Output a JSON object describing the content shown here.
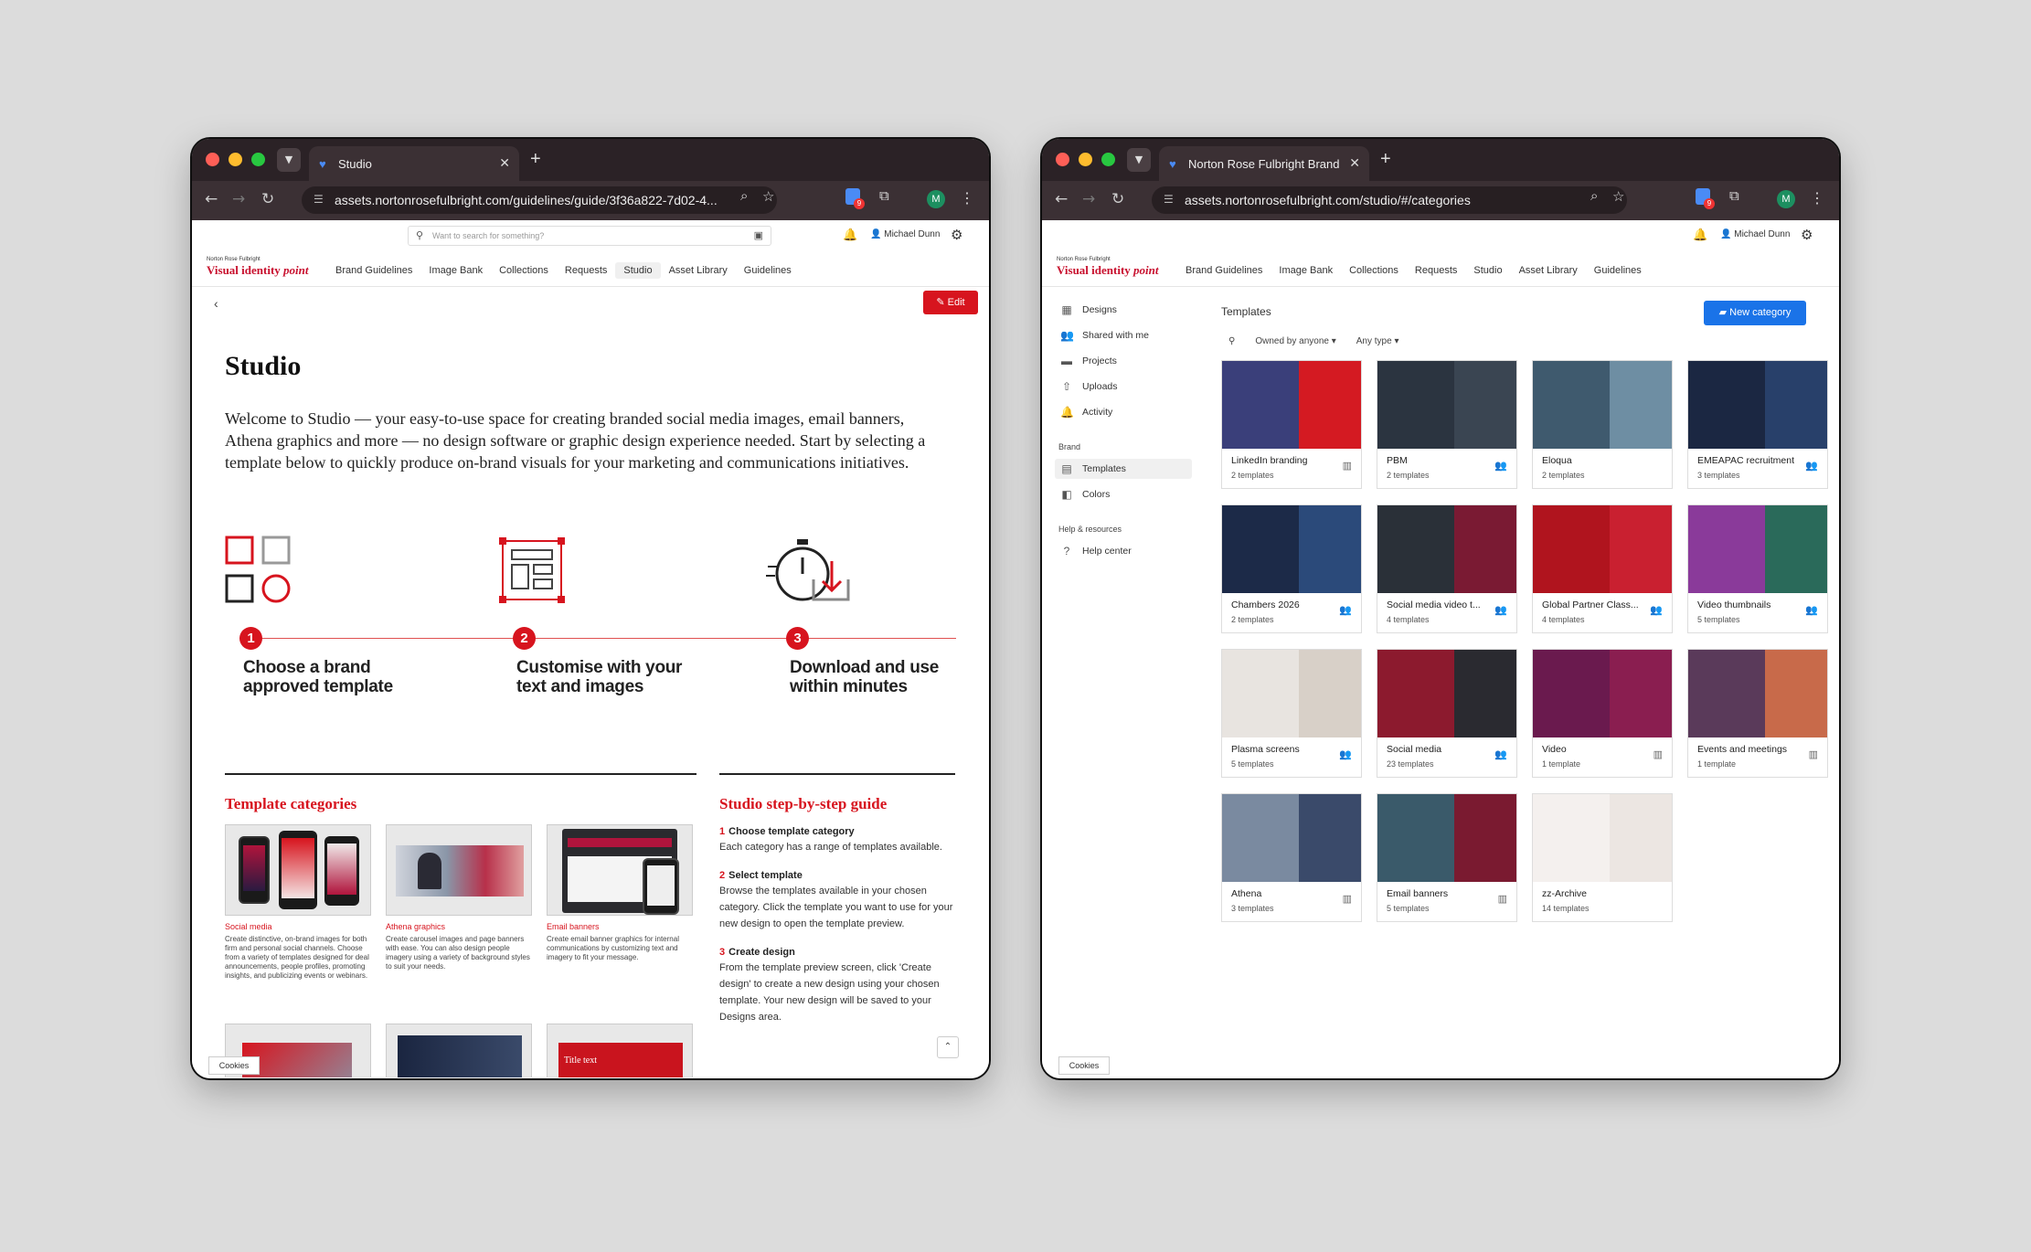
{
  "colors": {
    "brand_red": "#d7141e",
    "primary_blue": "#1a73e8",
    "chrome_dark": "#2b2226"
  },
  "win1": {
    "tab_title": "Studio",
    "url": "assets.nortonrosefulbright.com/guidelines/guide/3f36a822-7d02-4...",
    "search_placeholder": "Want to search for something?",
    "user": "Michael Dunn",
    "avatar": "M",
    "logo_small": "Norton Rose Fulbright",
    "logo_main": "Visual identity",
    "logo_em": "point",
    "nav": [
      "Brand Guidelines",
      "Image Bank",
      "Collections",
      "Requests",
      "Studio",
      "Asset Library",
      "Guidelines"
    ],
    "edit": "Edit",
    "title": "Studio",
    "intro": "Welcome to Studio — your easy-to-use space for creating branded social media images, email banners, Athena graphics and more — no design software or graphic design experience needed. Start by selecting a template below to quickly produce on-brand visuals for your marketing and communications initiatives.",
    "steps": [
      {
        "num": "1",
        "line1": "Choose a brand",
        "line2": "approved template"
      },
      {
        "num": "2",
        "line1": "Customise with your",
        "line2": "text and images"
      },
      {
        "num": "3",
        "line1": "Download and use",
        "line2": "within minutes"
      }
    ],
    "categories_heading": "Template categories",
    "cards": [
      {
        "title": "Social media",
        "desc": "Create distinctive, on-brand images for both firm and personal social channels. Choose from a variety of templates designed for deal announcements, people profiles, promoting insights, and publicizing events or webinars."
      },
      {
        "title": "Athena graphics",
        "desc": "Create carousel images and page banners with ease. You can also design people imagery using a variety of background styles to suit your needs."
      },
      {
        "title": "Email banners",
        "desc": "Create email banner graphics for internal communications by customizing text and imagery to fit your message."
      }
    ],
    "guide_heading": "Studio step-by-step guide",
    "guide": [
      {
        "num": "1",
        "title": "Choose template category",
        "desc": "Each category has a range of templates available."
      },
      {
        "num": "2",
        "title": "Select template",
        "desc": "Browse the templates available in your chosen category. Click the template you want to use for your new design to open the template preview."
      },
      {
        "num": "3",
        "title": "Create design",
        "desc": "From the template preview screen, click 'Create design' to create a new design using your chosen template. Your new design will be saved to your Designs area."
      }
    ],
    "cookies": "Cookies",
    "thumb_text": "Title text"
  },
  "win2": {
    "tab_title": "Norton Rose Fulbright Brand",
    "url": "assets.nortonrosefulbright.com/studio/#/categories",
    "user": "Michael Dunn",
    "avatar": "M",
    "logo_small": "Norton Rose Fulbright",
    "logo_main": "Visual identity",
    "logo_em": "point",
    "nav": [
      "Brand Guidelines",
      "Image Bank",
      "Collections",
      "Requests",
      "Studio",
      "Asset Library",
      "Guidelines"
    ],
    "side": [
      "Designs",
      "Shared with me",
      "Projects",
      "Uploads",
      "Activity"
    ],
    "brand_head": "Brand",
    "brand_items": [
      "Templates",
      "Colors"
    ],
    "help_head": "Help & resources",
    "help_items": [
      "Help center"
    ],
    "page_title": "Templates",
    "new_category": "New category",
    "filter_owner": "Owned by anyone",
    "filter_type": "Any type",
    "templates": [
      {
        "name": "LinkedIn branding",
        "count": "2 templates",
        "icon": "building",
        "c1": "#3a3f7a",
        "c2": "#d41a22"
      },
      {
        "name": "PBM",
        "count": "2 templates",
        "icon": "people",
        "c1": "#2b3440",
        "c2": "#3a4552"
      },
      {
        "name": "Eloqua",
        "count": "2 templates",
        "icon": "none",
        "c1": "#3f5a6e",
        "c2": "#6e8ea3"
      },
      {
        "name": "EMEAPAC recruitment",
        "count": "3 templates",
        "icon": "people",
        "c1": "#1b2742",
        "c2": "#28406a"
      },
      {
        "name": "Chambers 2026",
        "count": "2 templates",
        "icon": "people",
        "c1": "#1c2a48",
        "c2": "#2b4a7a"
      },
      {
        "name": "Social media video t...",
        "count": "4 templates",
        "icon": "people",
        "c1": "#2a3038",
        "c2": "#7a1a33"
      },
      {
        "name": "Global Partner Class...",
        "count": "4 templates",
        "icon": "people",
        "c1": "#b0141e",
        "c2": "#c92030"
      },
      {
        "name": "Video thumbnails",
        "count": "5 templates",
        "icon": "people",
        "c1": "#8a3a9a",
        "c2": "#2a6a5a"
      },
      {
        "name": "Plasma screens",
        "count": "5 templates",
        "icon": "people",
        "c1": "#e8e4e0",
        "c2": "#d8d0c8"
      },
      {
        "name": "Social media",
        "count": "23 templates",
        "icon": "people",
        "c1": "#8c1a2e",
        "c2": "#2a2a30"
      },
      {
        "name": "Video",
        "count": "1 template",
        "icon": "building",
        "c1": "#6a1a4e",
        "c2": "#8a1e50"
      },
      {
        "name": "Events and meetings",
        "count": "1 template",
        "icon": "building",
        "c1": "#5a3a5a",
        "c2": "#c86a4a"
      },
      {
        "name": "Athena",
        "count": "3 templates",
        "icon": "building",
        "c1": "#7a8aa0",
        "c2": "#3a4a6a"
      },
      {
        "name": "Email banners",
        "count": "5 templates",
        "icon": "building",
        "c1": "#3a5a6a",
        "c2": "#7a1a30"
      },
      {
        "name": "zz-Archive",
        "count": "14 templates",
        "icon": "none",
        "c1": "#f4f0ee",
        "c2": "#ece6e2"
      }
    ],
    "cookies": "Cookies"
  }
}
